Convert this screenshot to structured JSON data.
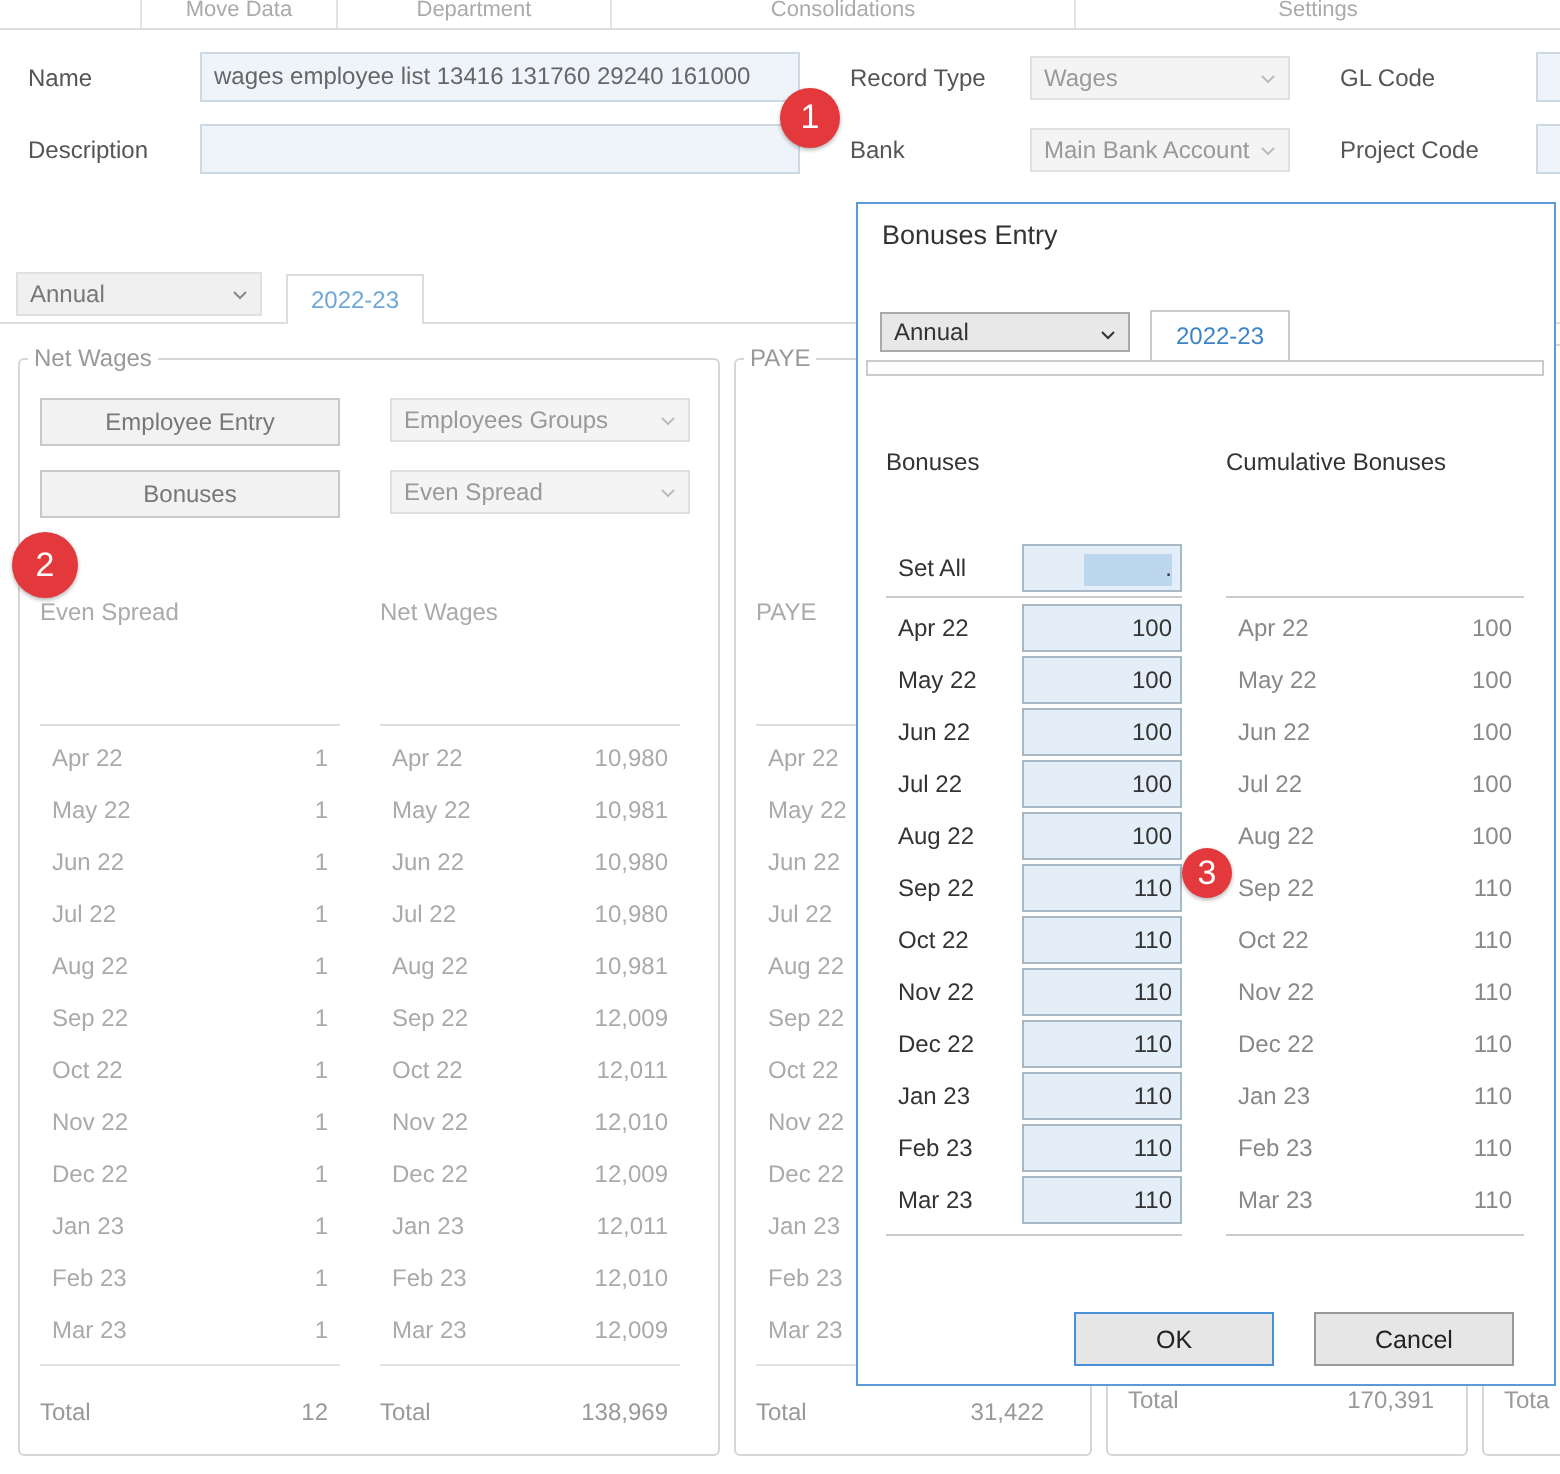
{
  "top_tabs": [
    "Move Data",
    "Department",
    "Consolidations",
    "Settings"
  ],
  "form": {
    "name": {
      "label": "Name",
      "value": "wages employee list 13416 131760 29240 161000"
    },
    "record_type": {
      "label": "Record Type",
      "value": "Wages"
    },
    "gl_code": {
      "label": "GL Code"
    },
    "description": {
      "label": "Description"
    },
    "bank": {
      "label": "Bank",
      "value": "Main Bank Account"
    },
    "project_code": {
      "label": "Project Code"
    }
  },
  "period_select": "Annual",
  "period_tab": {
    "label": "2022-23",
    "selected": true
  },
  "net_wages": {
    "title": "Net Wages",
    "buttons": [
      "Employee Entry",
      "Bonuses"
    ],
    "selects": [
      "Employees Groups",
      "Even Spread"
    ],
    "columns": [
      {
        "header": "Even Spread",
        "total_label": "Total",
        "total": "12",
        "rows": [
          {
            "month": "Apr 22",
            "value": "1"
          },
          {
            "month": "May 22",
            "value": "1"
          },
          {
            "month": "Jun 22",
            "value": "1"
          },
          {
            "month": "Jul 22",
            "value": "1"
          },
          {
            "month": "Aug 22",
            "value": "1"
          },
          {
            "month": "Sep 22",
            "value": "1"
          },
          {
            "month": "Oct 22",
            "value": "1"
          },
          {
            "month": "Nov 22",
            "value": "1"
          },
          {
            "month": "Dec 22",
            "value": "1"
          },
          {
            "month": "Jan 23",
            "value": "1"
          },
          {
            "month": "Feb 23",
            "value": "1"
          },
          {
            "month": "Mar 23",
            "value": "1"
          }
        ]
      },
      {
        "header": "Net Wages",
        "total_label": "Total",
        "total": "138,969",
        "rows": [
          {
            "month": "Apr 22",
            "value": "10,980"
          },
          {
            "month": "May 22",
            "value": "10,981"
          },
          {
            "month": "Jun 22",
            "value": "10,980"
          },
          {
            "month": "Jul 22",
            "value": "10,980"
          },
          {
            "month": "Aug 22",
            "value": "10,981"
          },
          {
            "month": "Sep 22",
            "value": "12,009"
          },
          {
            "month": "Oct 22",
            "value": "12,011"
          },
          {
            "month": "Nov 22",
            "value": "12,010"
          },
          {
            "month": "Dec 22",
            "value": "12,009"
          },
          {
            "month": "Jan 23",
            "value": "12,011"
          },
          {
            "month": "Feb 23",
            "value": "12,010"
          },
          {
            "month": "Mar 23",
            "value": "12,009"
          }
        ]
      }
    ]
  },
  "paye": {
    "title": "PAYE",
    "header": "PAYE",
    "months": [
      "Apr 22",
      "May 22",
      "Jun 22",
      "Jul 22",
      "Aug 22",
      "Sep 22",
      "Oct 22",
      "Nov 22",
      "Dec 22",
      "Jan 23",
      "Feb 23",
      "Mar 23"
    ],
    "total_label": "Total",
    "total": "31,422"
  },
  "panel_3": {
    "total_label": "Total",
    "total": "170,391"
  },
  "panel_4": {
    "total_label": "Tota"
  },
  "dialog": {
    "title": "Bonuses Entry",
    "period_select": "Annual",
    "tab": {
      "label": "2022-23",
      "selected": true
    },
    "bonuses_header": "Bonuses",
    "cumulative_header": "Cumulative Bonuses",
    "set_all": {
      "label": "Set All",
      "value": "."
    },
    "rows": [
      {
        "month": "Apr 22",
        "value": "100"
      },
      {
        "month": "May 22",
        "value": "100"
      },
      {
        "month": "Jun 22",
        "value": "100"
      },
      {
        "month": "Jul 22",
        "value": "100"
      },
      {
        "month": "Aug 22",
        "value": "100"
      },
      {
        "month": "Sep 22",
        "value": "110"
      },
      {
        "month": "Oct 22",
        "value": "110"
      },
      {
        "month": "Nov 22",
        "value": "110"
      },
      {
        "month": "Dec 22",
        "value": "110"
      },
      {
        "month": "Jan 23",
        "value": "110"
      },
      {
        "month": "Feb 23",
        "value": "110"
      },
      {
        "month": "Mar 23",
        "value": "110"
      }
    ],
    "cumulative_rows": [
      {
        "month": "Apr 22",
        "value": "100"
      },
      {
        "month": "May 22",
        "value": "100"
      },
      {
        "month": "Jun 22",
        "value": "100"
      },
      {
        "month": "Jul 22",
        "value": "100"
      },
      {
        "month": "Aug 22",
        "value": "100"
      },
      {
        "month": "Sep 22",
        "value": "110"
      },
      {
        "month": "Oct 22",
        "value": "110"
      },
      {
        "month": "Nov 22",
        "value": "110"
      },
      {
        "month": "Dec 22",
        "value": "110"
      },
      {
        "month": "Jan 23",
        "value": "110"
      },
      {
        "month": "Feb 23",
        "value": "110"
      },
      {
        "month": "Mar 23",
        "value": "110"
      }
    ],
    "buttons": [
      {
        "label": "OK",
        "kind": "primary"
      },
      {
        "label": "Cancel",
        "kind": "secondary"
      }
    ]
  },
  "badges": [
    "1",
    "2",
    "3"
  ]
}
